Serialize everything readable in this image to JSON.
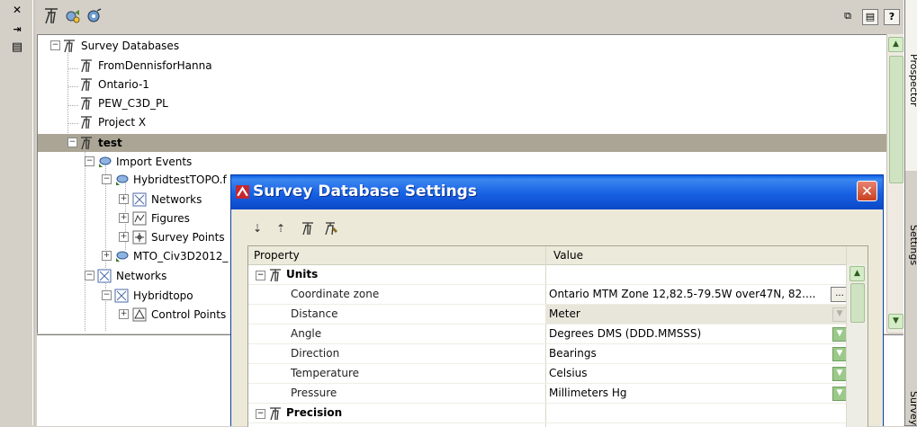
{
  "left_strip": {
    "close_glyph": "✕",
    "autohide_glyph": "⇥",
    "menu_glyph": "▤"
  },
  "toolbar": {
    "button_1": "⧉",
    "button_2": "▤",
    "help_button": "?"
  },
  "tree": {
    "root": "Survey Databases",
    "databases": [
      "FromDennisforHanna",
      "Ontario-1",
      "PEW_C3D_PL",
      "Project X",
      "test"
    ],
    "import_events": "Import Events",
    "hybrid_event": "HybridtestTOPO.f",
    "networks_child": "Networks",
    "figures": "Figures",
    "survey_points": "Survey Points",
    "mto_event": "MTO_Civ3D2012_",
    "networks": "Networks",
    "hybridtopo": "Hybridtopo",
    "control_points": "Control Points"
  },
  "right_tabs": [
    "Prospector",
    "Settings",
    "Survey"
  ],
  "dialog": {
    "title": "Survey Database Settings",
    "close": "✕",
    "grid": {
      "headers": {
        "property": "Property",
        "value": "Value"
      },
      "categories": {
        "units": "Units",
        "precision": "Precision"
      },
      "rows": [
        {
          "name": "Coordinate zone",
          "value": "Ontario MTM Zone 12,82.5-79.5W over47N, 82...."
        },
        {
          "name": "Distance",
          "value": "Meter"
        },
        {
          "name": "Angle",
          "value": "Degrees DMS (DDD.MMSSS)"
        },
        {
          "name": "Direction",
          "value": "Bearings"
        },
        {
          "name": "Temperature",
          "value": "Celsius"
        },
        {
          "name": "Pressure",
          "value": "Millimeters Hg"
        }
      ],
      "ellipsis": "..."
    }
  }
}
